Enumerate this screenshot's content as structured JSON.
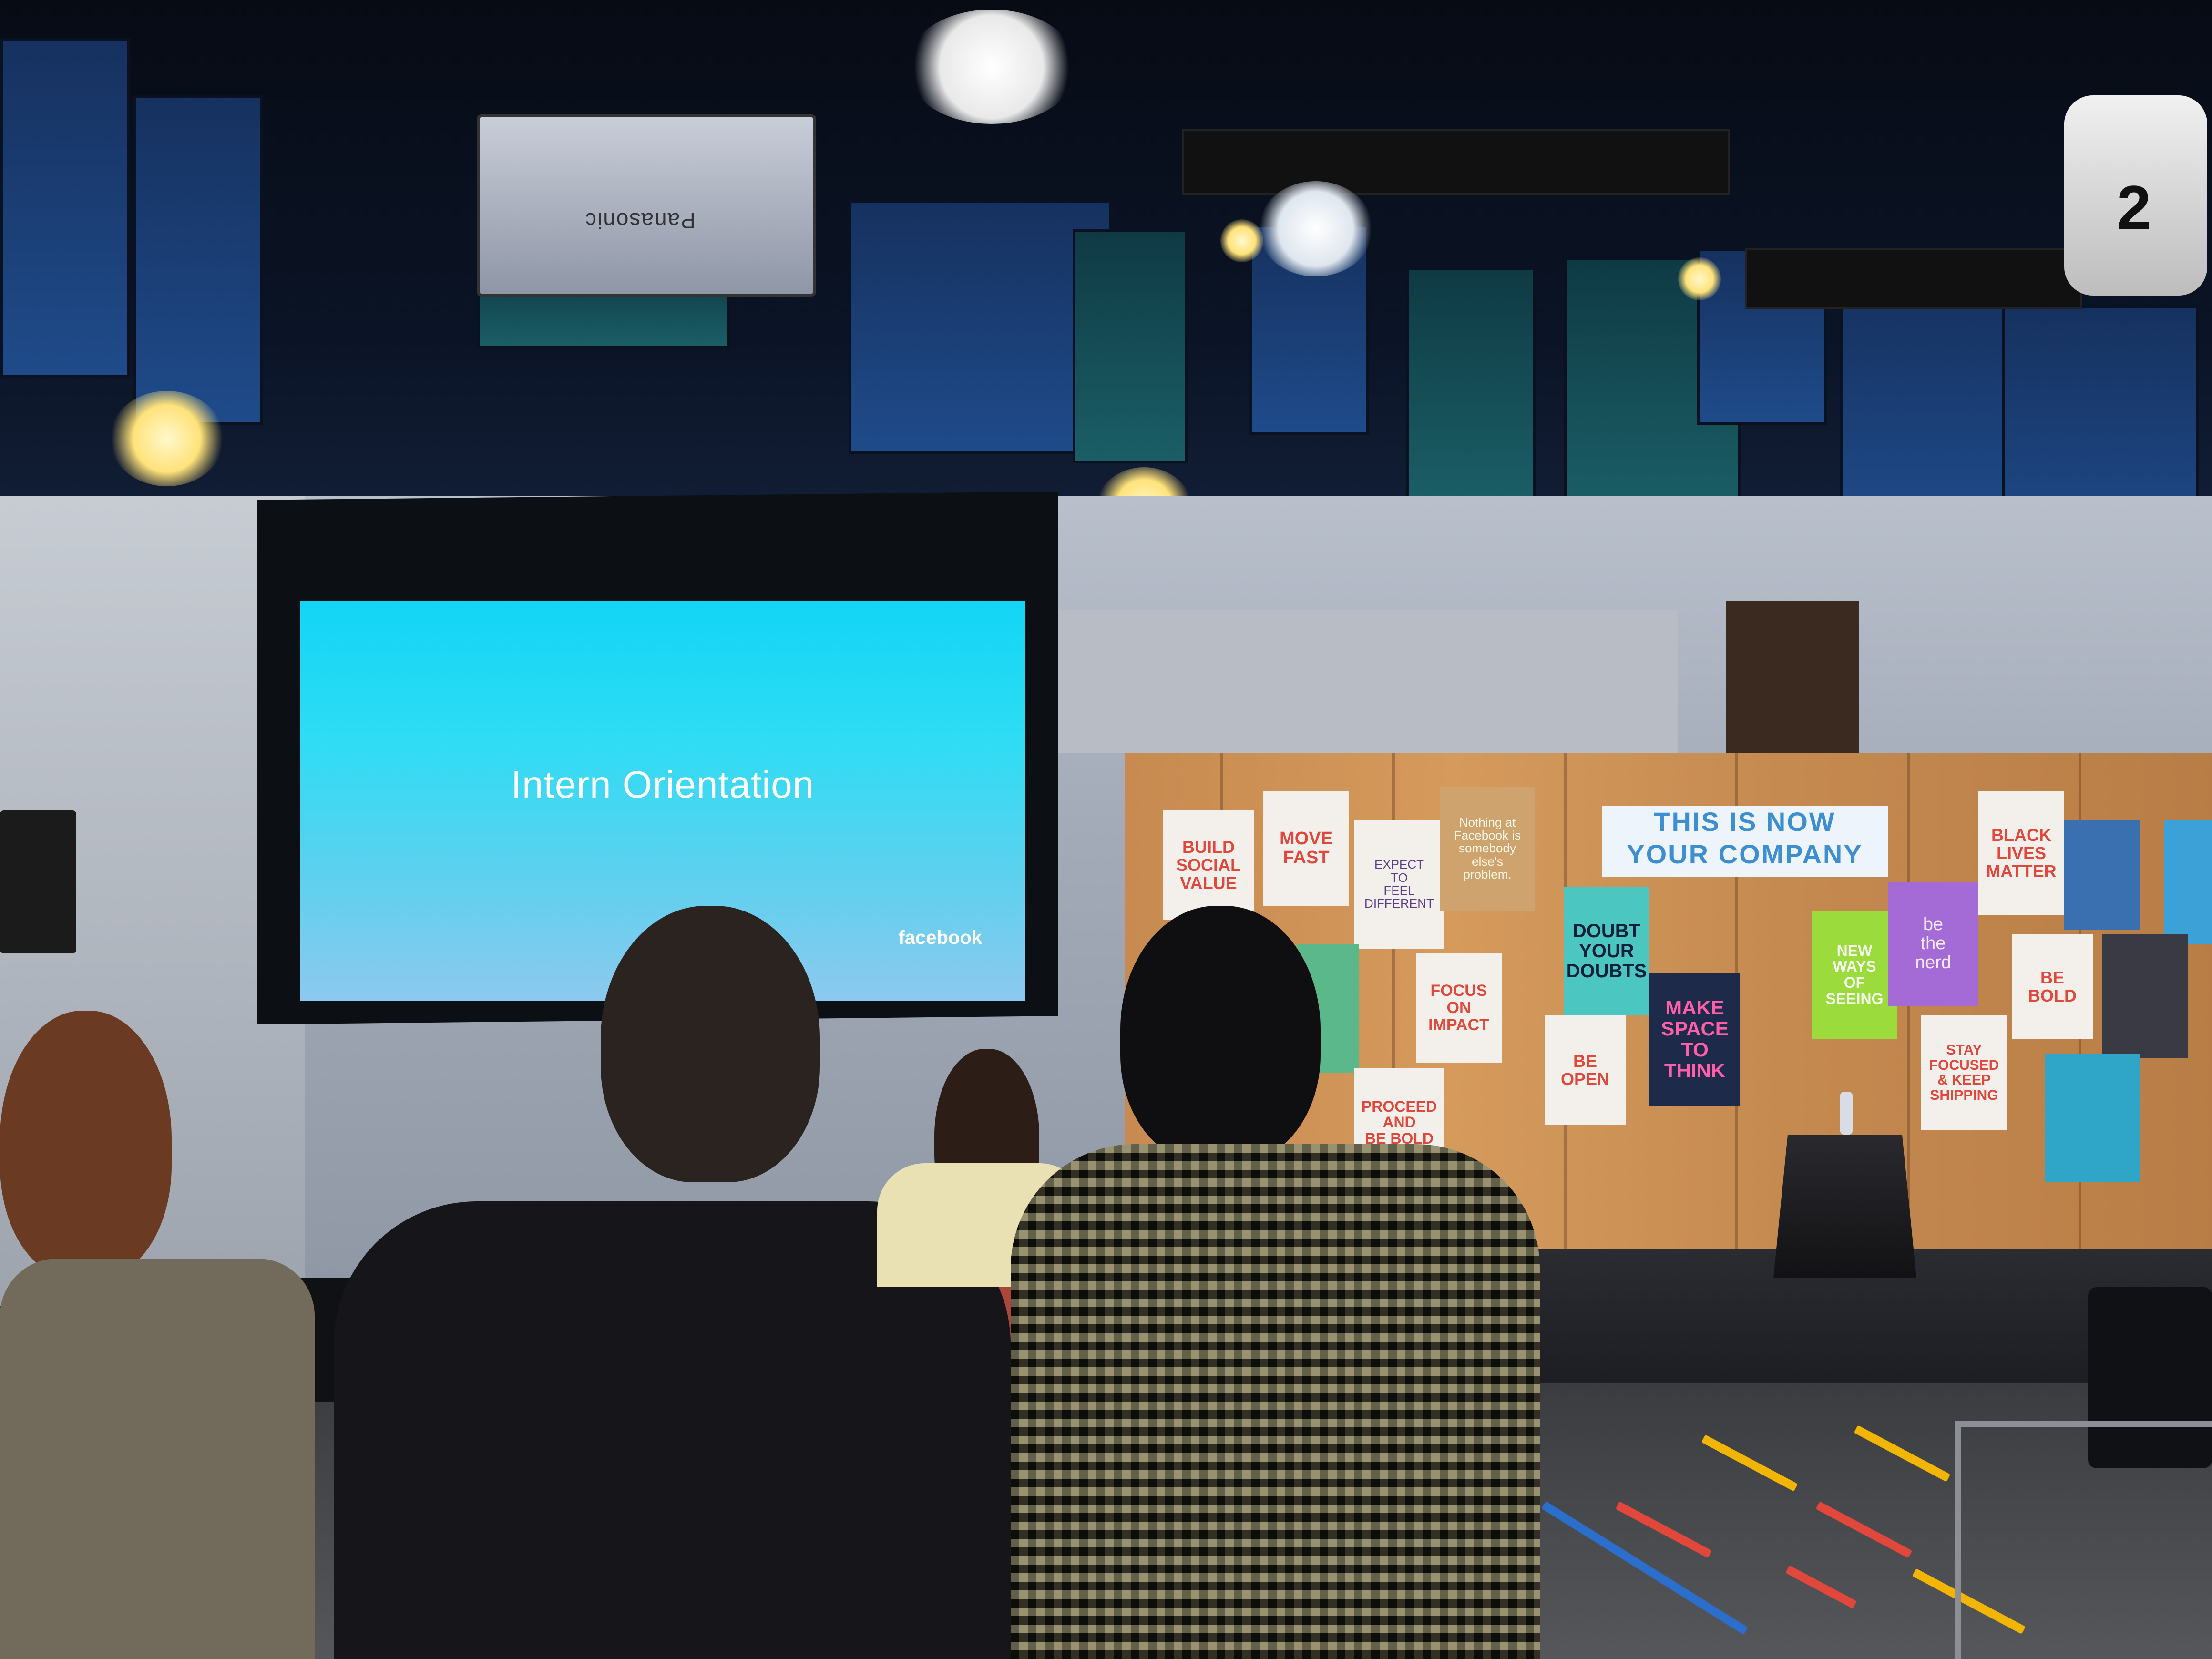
{
  "scene": {
    "projector_brand": "Panasonic",
    "camera_number": "2",
    "screen": {
      "title": "Intern Orientation",
      "logo": "facebook"
    },
    "banner": {
      "line1": "THIS IS NOW",
      "line2": "YOUR COMPANY"
    },
    "posters": [
      {
        "id": "build-social-value",
        "text": "BUILD\nSOCIAL\nVALUE"
      },
      {
        "id": "move-fast",
        "text": "MOVE\nFAST"
      },
      {
        "id": "expect-to-feel-different",
        "text": "EXPECT\nTO\nFEEL\nDIFFERENT"
      },
      {
        "id": "nothing-at-facebook",
        "text": "Nothing at\nFacebook is\nsomebody\nelse's\nproblem."
      },
      {
        "id": "doubt-your-doubts",
        "text": "DOUBT\nYOUR\nDOUBTS"
      },
      {
        "id": "focus-on-impact",
        "text": "FOCUS\nON\nIMPACT"
      },
      {
        "id": "be-open",
        "text": "BE\nOPEN"
      },
      {
        "id": "proceed-and-be-bold",
        "text": "PROCEED\nAND\nBE BOLD"
      },
      {
        "id": "make-space-to-think",
        "text": "MAKE\nSPACE\nTO\nTHINK"
      },
      {
        "id": "new-ways-of-seeing",
        "text": "NEW\nWAYS\nOF\nSEEING"
      },
      {
        "id": "be-the-nerd",
        "text": "be\nthe\nnerd"
      },
      {
        "id": "black-lives-matter",
        "text": "BLACK\nLIVES\nMATTER"
      },
      {
        "id": "be-bold",
        "text": "BE BOLD"
      },
      {
        "id": "stay-focused",
        "text": "STAY\nFOCUSED\n& KEEP\nSHIPPING"
      }
    ]
  }
}
